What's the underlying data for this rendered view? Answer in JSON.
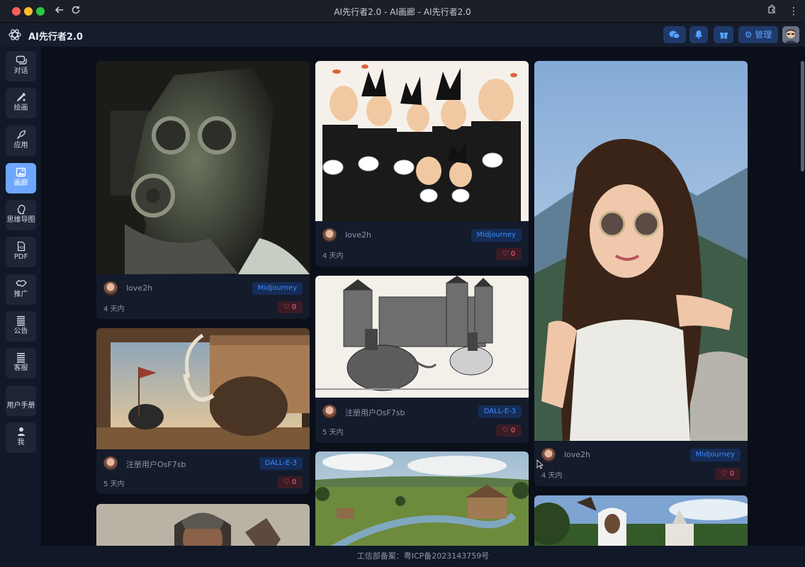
{
  "browser": {
    "title": "AI先行者2.0 - AI画廊 - AI先行者2.0",
    "back_icon": "arrow-left-icon",
    "reload_icon": "reload-icon"
  },
  "header": {
    "brand": "AI先行者2.0",
    "buttons": [
      {
        "icon": "wechat-icon"
      },
      {
        "icon": "bell-icon"
      },
      {
        "icon": "gift-icon"
      },
      {
        "icon": "gear-icon",
        "label": "管理"
      }
    ]
  },
  "sidebar": {
    "items": [
      {
        "label": "对话",
        "icon": "chat-icon"
      },
      {
        "label": "绘画",
        "icon": "paint-icon"
      },
      {
        "label": "应用",
        "icon": "rocket-icon"
      },
      {
        "label": "画廊",
        "icon": "gallery-icon",
        "active": true
      },
      {
        "label": "思维导图",
        "icon": "mindmap-icon"
      },
      {
        "label": "PDF",
        "icon": "pdf-icon"
      },
      {
        "label": "推广",
        "icon": "handshake-icon"
      },
      {
        "label": "公告",
        "icon": "notice-icon"
      },
      {
        "label": "客服",
        "icon": "support-icon"
      },
      {
        "label": "用户手册",
        "icon": ""
      },
      {
        "label": "我",
        "icon": "user-icon"
      }
    ]
  },
  "gallery": {
    "cards": [
      {
        "user": "love2h",
        "model": "Midjourney",
        "time": "4 天内",
        "likes": "0",
        "subject": "gas-mask-statue"
      },
      {
        "user": "注册用户OsF7sb",
        "model": "DALL-E-3",
        "time": "5 天内",
        "likes": "0",
        "subject": "warrior-mammoth-gate"
      },
      {
        "user": "",
        "model": "",
        "time": "",
        "likes": "",
        "subject": "warrior-portrait"
      },
      {
        "user": "love2h",
        "model": "Midjourney",
        "time": "4 天内",
        "likes": "0",
        "subject": "anime-funeral"
      },
      {
        "user": "注册用户OsF7sb",
        "model": "DALL-E-3",
        "time": "5 天内",
        "likes": "0",
        "subject": "sketch-mammoth-castle"
      },
      {
        "user": "",
        "model": "",
        "time": "",
        "likes": "",
        "subject": "village-landscape"
      },
      {
        "user": "love2h",
        "model": "Midjourney",
        "time": "4 天内",
        "likes": "0",
        "subject": "mountain-selfie"
      },
      {
        "user": "",
        "model": "",
        "time": "",
        "likes": "",
        "subject": "hooded-assassin"
      }
    ]
  },
  "footer": {
    "text": "工信部备案：粤ICP备2023143759号"
  }
}
